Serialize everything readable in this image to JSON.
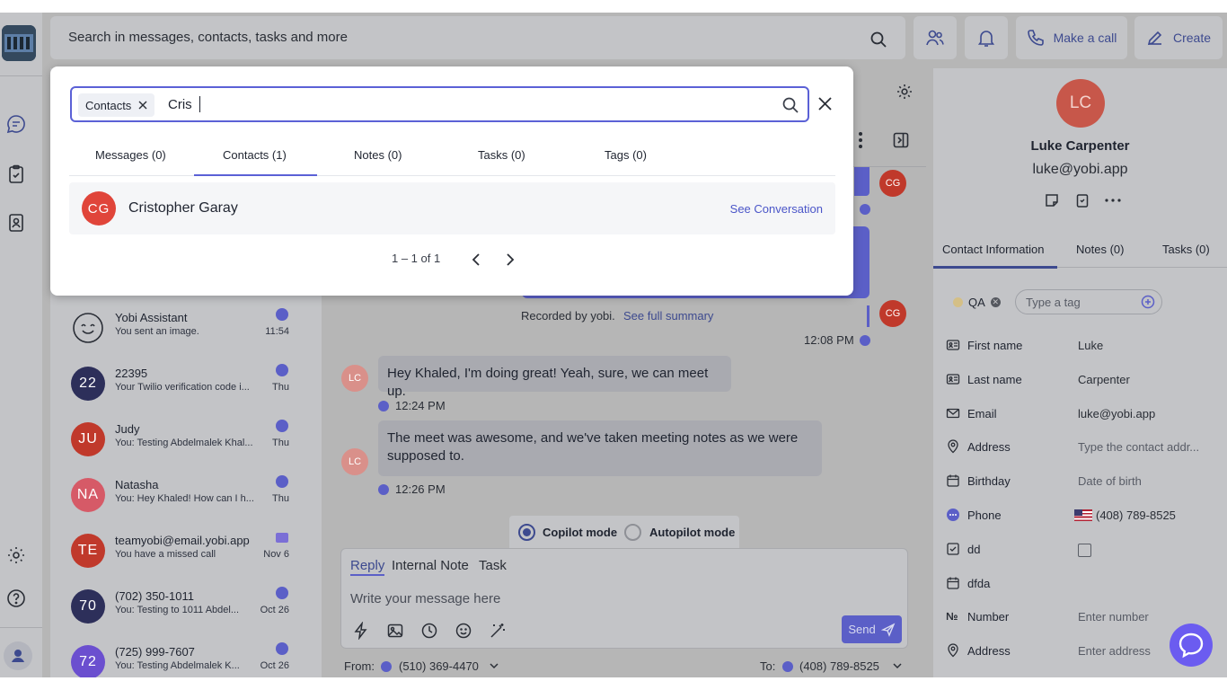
{
  "search": {
    "placeholder": "Search in messages, contacts, tasks and more"
  },
  "topbar": {
    "make_call": "Make a call",
    "create": "Create"
  },
  "conversations": [
    {
      "avatar": "",
      "name": "Yobi Assistant",
      "preview": "You sent an image.",
      "time": "11:54",
      "color": "#c3c4c7",
      "channel": "chat"
    },
    {
      "avatar": "22",
      "name": "22395",
      "preview": "Your Twilio verification code i...",
      "time": "Thu",
      "color": "#2d2f5a",
      "channel": "chat"
    },
    {
      "avatar": "JU",
      "name": "Judy",
      "preview": "You: Testing Abdelmalek Khal...",
      "time": "Thu",
      "color": "#c0392b",
      "channel": "chat"
    },
    {
      "avatar": "NA",
      "name": "Natasha",
      "preview": "You: Hey Khaled! How can I h...",
      "time": "Thu",
      "color": "#d65a67",
      "channel": "chat"
    },
    {
      "avatar": "TE",
      "name": "teamyobi@email.yobi.app",
      "preview": "You have a missed call",
      "time": "Nov 6",
      "color": "#c0392b",
      "channel": "email"
    },
    {
      "avatar": "70",
      "name": "(702) 350-1011",
      "preview": "You: Testing to 1011 Abdel...",
      "time": "Oct 26",
      "color": "#2d2f5a",
      "channel": "chat"
    },
    {
      "avatar": "72",
      "name": "(725) 999-7607",
      "preview": "You: Testing Abdelmalek K...",
      "time": "Oct 26",
      "color": "#6b4fcf",
      "channel": "chat"
    }
  ],
  "chat": {
    "recorded_by": "Recorded by yobi.",
    "see_full_summary": "See full summary",
    "time_1208": "12:08 PM",
    "msg1": "Hey Khaled, I'm doing great! Yeah, sure, we can meet up.",
    "time_1224": "12:24 PM",
    "msg2": "The meet was awesome, and we've taken meeting notes as we were supposed to.",
    "time_1226": "12:26 PM",
    "avatar_lc": "LC",
    "avatar_cg": "CG",
    "copilot": "Copilot mode",
    "autopilot": "Autopilot mode",
    "tab_reply": "Reply",
    "tab_note": "Internal Note",
    "tab_task": "Task",
    "composer_placeholder": "Write your message here",
    "send": "Send",
    "from_label": "From:",
    "from_number": "(510) 369-4470",
    "to_label": "To:",
    "to_number": "(408) 789-8525"
  },
  "contact": {
    "initials": "LC",
    "name": "Luke Carpenter",
    "email": "luke@yobi.app",
    "tabs": [
      "Contact Information",
      "Notes (0)",
      "Tasks (0)"
    ],
    "tag": "QA",
    "tag_placeholder": "Type a tag",
    "fields": [
      {
        "label": "First name",
        "value": "Luke",
        "placeholder": false,
        "icon": "id-card-icon"
      },
      {
        "label": "Last name",
        "value": "Carpenter",
        "placeholder": false,
        "icon": "id-card-icon"
      },
      {
        "label": "Email",
        "value": "luke@yobi.app",
        "placeholder": false,
        "icon": "mail-icon"
      },
      {
        "label": "Address",
        "value": "Type the contact addr...",
        "placeholder": true,
        "icon": "location-icon"
      },
      {
        "label": "Birthday",
        "value": "Date of birth",
        "placeholder": true,
        "icon": "calendar-icon"
      },
      {
        "label": "Phone",
        "value": "(408) 789-8525",
        "placeholder": false,
        "icon": "chat-bubble-icon"
      },
      {
        "label": "dd",
        "value": "",
        "placeholder": false,
        "icon": "checkbox-icon"
      },
      {
        "label": "dfda",
        "value": "",
        "placeholder": false,
        "icon": "calendar-icon"
      },
      {
        "label": "Number",
        "value": "Enter number",
        "placeholder": true,
        "icon": "number-icon"
      },
      {
        "label": "Address",
        "value": "Enter address",
        "placeholder": true,
        "icon": "location-icon"
      }
    ]
  },
  "popup": {
    "chip": "Contacts",
    "query": "Cris",
    "tabs": [
      "Messages (0)",
      "Contacts (1)",
      "Notes (0)",
      "Tasks (0)",
      "Tags (0)"
    ],
    "active_tab": 1,
    "result": {
      "initials": "CG",
      "name": "Cristopher Garay",
      "action": "See Conversation"
    },
    "pager": "1 – 1 of 1"
  },
  "colors": {
    "accent": "#5b61d6",
    "danger": "#d9453a",
    "overlay": "#b6b6b6"
  }
}
